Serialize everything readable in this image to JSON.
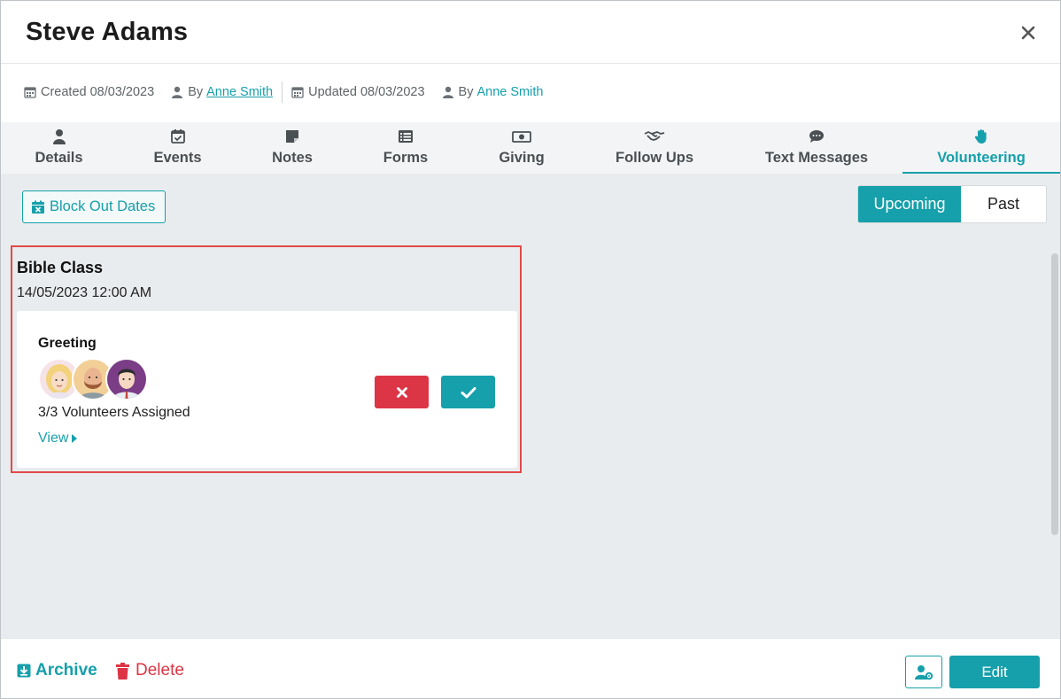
{
  "header": {
    "title": "Steve Adams",
    "close_icon": "close-icon"
  },
  "meta": {
    "created_label": "Created 08/03/2023",
    "created_by_prefix": "By",
    "created_by": "Anne Smith",
    "updated_label": "Updated 08/03/2023",
    "updated_by_prefix": "By",
    "updated_by": "Anne Smith"
  },
  "tabs": [
    {
      "label": "Details",
      "icon": "user-icon"
    },
    {
      "label": "Events",
      "icon": "calendar-check-icon"
    },
    {
      "label": "Notes",
      "icon": "sticky-note-icon"
    },
    {
      "label": "Forms",
      "icon": "list-icon"
    },
    {
      "label": "Giving",
      "icon": "money-icon"
    },
    {
      "label": "Follow Ups",
      "icon": "handshake-icon"
    },
    {
      "label": "Text Messages",
      "icon": "comment-icon"
    },
    {
      "label": "Volunteering",
      "icon": "hand-icon",
      "active": true
    }
  ],
  "toolbar": {
    "block_out_label": "Block Out Dates",
    "toggle": {
      "upcoming": "Upcoming",
      "past": "Past",
      "selected": "Upcoming"
    }
  },
  "event": {
    "title": "Bible Class",
    "date": "14/05/2023 12:00 AM",
    "role": "Greeting",
    "assigned": "3/3 Volunteers Assigned",
    "view_label": "View"
  },
  "footer": {
    "archive_label": "Archive",
    "delete_label": "Delete",
    "edit_label": "Edit"
  },
  "colors": {
    "accent": "#16a0ab",
    "danger": "#dc3545",
    "highlight_border": "#e24848"
  }
}
